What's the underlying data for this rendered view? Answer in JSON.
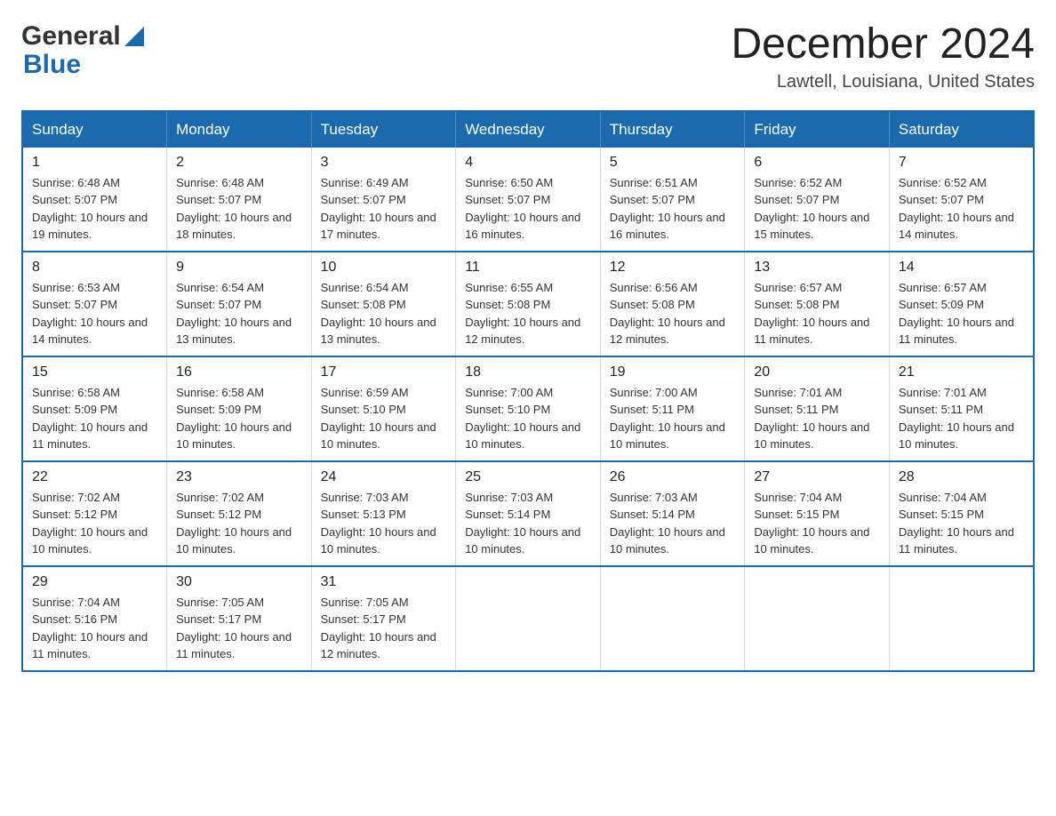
{
  "header": {
    "logo_general": "General",
    "logo_blue": "Blue",
    "month_title": "December 2024",
    "location": "Lawtell, Louisiana, United States"
  },
  "days_of_week": [
    "Sunday",
    "Monday",
    "Tuesday",
    "Wednesday",
    "Thursday",
    "Friday",
    "Saturday"
  ],
  "weeks": [
    [
      {
        "day": "1",
        "sunrise": "Sunrise: 6:48 AM",
        "sunset": "Sunset: 5:07 PM",
        "daylight": "Daylight: 10 hours and 19 minutes."
      },
      {
        "day": "2",
        "sunrise": "Sunrise: 6:48 AM",
        "sunset": "Sunset: 5:07 PM",
        "daylight": "Daylight: 10 hours and 18 minutes."
      },
      {
        "day": "3",
        "sunrise": "Sunrise: 6:49 AM",
        "sunset": "Sunset: 5:07 PM",
        "daylight": "Daylight: 10 hours and 17 minutes."
      },
      {
        "day": "4",
        "sunrise": "Sunrise: 6:50 AM",
        "sunset": "Sunset: 5:07 PM",
        "daylight": "Daylight: 10 hours and 16 minutes."
      },
      {
        "day": "5",
        "sunrise": "Sunrise: 6:51 AM",
        "sunset": "Sunset: 5:07 PM",
        "daylight": "Daylight: 10 hours and 16 minutes."
      },
      {
        "day": "6",
        "sunrise": "Sunrise: 6:52 AM",
        "sunset": "Sunset: 5:07 PM",
        "daylight": "Daylight: 10 hours and 15 minutes."
      },
      {
        "day": "7",
        "sunrise": "Sunrise: 6:52 AM",
        "sunset": "Sunset: 5:07 PM",
        "daylight": "Daylight: 10 hours and 14 minutes."
      }
    ],
    [
      {
        "day": "8",
        "sunrise": "Sunrise: 6:53 AM",
        "sunset": "Sunset: 5:07 PM",
        "daylight": "Daylight: 10 hours and 14 minutes."
      },
      {
        "day": "9",
        "sunrise": "Sunrise: 6:54 AM",
        "sunset": "Sunset: 5:07 PM",
        "daylight": "Daylight: 10 hours and 13 minutes."
      },
      {
        "day": "10",
        "sunrise": "Sunrise: 6:54 AM",
        "sunset": "Sunset: 5:08 PM",
        "daylight": "Daylight: 10 hours and 13 minutes."
      },
      {
        "day": "11",
        "sunrise": "Sunrise: 6:55 AM",
        "sunset": "Sunset: 5:08 PM",
        "daylight": "Daylight: 10 hours and 12 minutes."
      },
      {
        "day": "12",
        "sunrise": "Sunrise: 6:56 AM",
        "sunset": "Sunset: 5:08 PM",
        "daylight": "Daylight: 10 hours and 12 minutes."
      },
      {
        "day": "13",
        "sunrise": "Sunrise: 6:57 AM",
        "sunset": "Sunset: 5:08 PM",
        "daylight": "Daylight: 10 hours and 11 minutes."
      },
      {
        "day": "14",
        "sunrise": "Sunrise: 6:57 AM",
        "sunset": "Sunset: 5:09 PM",
        "daylight": "Daylight: 10 hours and 11 minutes."
      }
    ],
    [
      {
        "day": "15",
        "sunrise": "Sunrise: 6:58 AM",
        "sunset": "Sunset: 5:09 PM",
        "daylight": "Daylight: 10 hours and 11 minutes."
      },
      {
        "day": "16",
        "sunrise": "Sunrise: 6:58 AM",
        "sunset": "Sunset: 5:09 PM",
        "daylight": "Daylight: 10 hours and 10 minutes."
      },
      {
        "day": "17",
        "sunrise": "Sunrise: 6:59 AM",
        "sunset": "Sunset: 5:10 PM",
        "daylight": "Daylight: 10 hours and 10 minutes."
      },
      {
        "day": "18",
        "sunrise": "Sunrise: 7:00 AM",
        "sunset": "Sunset: 5:10 PM",
        "daylight": "Daylight: 10 hours and 10 minutes."
      },
      {
        "day": "19",
        "sunrise": "Sunrise: 7:00 AM",
        "sunset": "Sunset: 5:11 PM",
        "daylight": "Daylight: 10 hours and 10 minutes."
      },
      {
        "day": "20",
        "sunrise": "Sunrise: 7:01 AM",
        "sunset": "Sunset: 5:11 PM",
        "daylight": "Daylight: 10 hours and 10 minutes."
      },
      {
        "day": "21",
        "sunrise": "Sunrise: 7:01 AM",
        "sunset": "Sunset: 5:11 PM",
        "daylight": "Daylight: 10 hours and 10 minutes."
      }
    ],
    [
      {
        "day": "22",
        "sunrise": "Sunrise: 7:02 AM",
        "sunset": "Sunset: 5:12 PM",
        "daylight": "Daylight: 10 hours and 10 minutes."
      },
      {
        "day": "23",
        "sunrise": "Sunrise: 7:02 AM",
        "sunset": "Sunset: 5:12 PM",
        "daylight": "Daylight: 10 hours and 10 minutes."
      },
      {
        "day": "24",
        "sunrise": "Sunrise: 7:03 AM",
        "sunset": "Sunset: 5:13 PM",
        "daylight": "Daylight: 10 hours and 10 minutes."
      },
      {
        "day": "25",
        "sunrise": "Sunrise: 7:03 AM",
        "sunset": "Sunset: 5:14 PM",
        "daylight": "Daylight: 10 hours and 10 minutes."
      },
      {
        "day": "26",
        "sunrise": "Sunrise: 7:03 AM",
        "sunset": "Sunset: 5:14 PM",
        "daylight": "Daylight: 10 hours and 10 minutes."
      },
      {
        "day": "27",
        "sunrise": "Sunrise: 7:04 AM",
        "sunset": "Sunset: 5:15 PM",
        "daylight": "Daylight: 10 hours and 10 minutes."
      },
      {
        "day": "28",
        "sunrise": "Sunrise: 7:04 AM",
        "sunset": "Sunset: 5:15 PM",
        "daylight": "Daylight: 10 hours and 11 minutes."
      }
    ],
    [
      {
        "day": "29",
        "sunrise": "Sunrise: 7:04 AM",
        "sunset": "Sunset: 5:16 PM",
        "daylight": "Daylight: 10 hours and 11 minutes."
      },
      {
        "day": "30",
        "sunrise": "Sunrise: 7:05 AM",
        "sunset": "Sunset: 5:17 PM",
        "daylight": "Daylight: 10 hours and 11 minutes."
      },
      {
        "day": "31",
        "sunrise": "Sunrise: 7:05 AM",
        "sunset": "Sunset: 5:17 PM",
        "daylight": "Daylight: 10 hours and 12 minutes."
      },
      null,
      null,
      null,
      null
    ]
  ]
}
